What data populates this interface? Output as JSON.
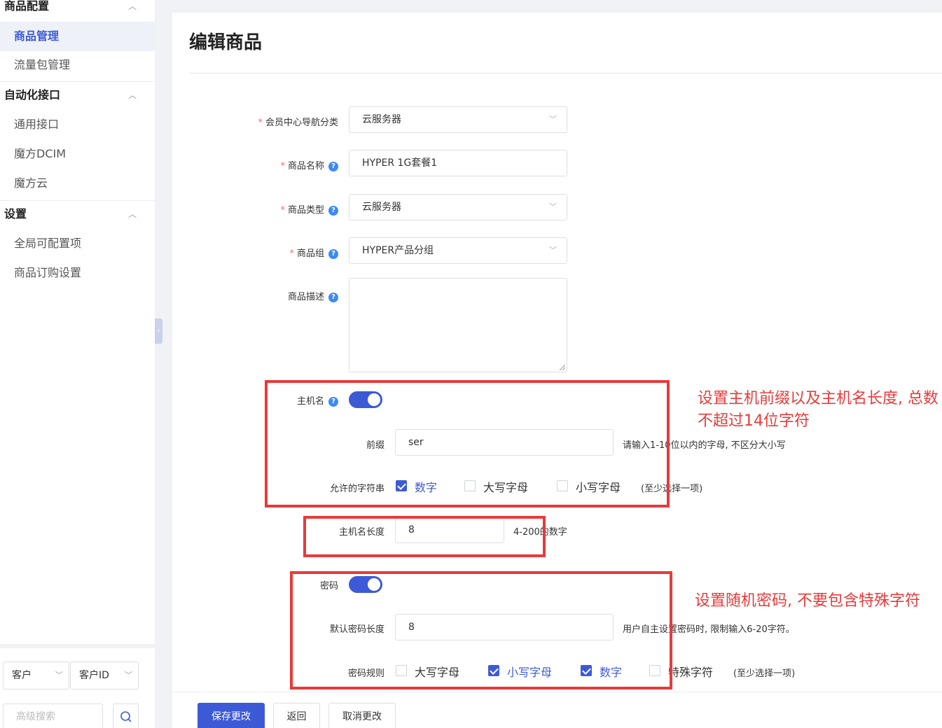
{
  "sidebar": {
    "sections": [
      {
        "title": "商品配置",
        "items": [
          "商品管理",
          "流量包管理"
        ]
      },
      {
        "title": "自动化接口",
        "items": [
          "通用接口",
          "魔方DCIM",
          "魔方云"
        ]
      },
      {
        "title": "设置",
        "items": [
          "全局可配置项",
          "商品订购设置"
        ]
      }
    ],
    "footer": {
      "filter_select": "客户",
      "id_select": "客户ID",
      "advanced_search_placeholder": "高级搜索"
    }
  },
  "page": {
    "title": "编辑商品"
  },
  "form": {
    "nav_category": {
      "label": "会员中心导航分类",
      "value": "云服务器"
    },
    "product_name": {
      "label": "商品名称",
      "value": "HYPER 1G套餐1"
    },
    "product_type": {
      "label": "商品类型",
      "value": "云服务器"
    },
    "product_group": {
      "label": "商品组",
      "value": "HYPER产品分组"
    },
    "product_desc": {
      "label": "商品描述",
      "value": ""
    },
    "hostname": {
      "label": "主机名",
      "enabled": true,
      "prefix_label": "前缀",
      "prefix_value": "ser",
      "prefix_hint": "请输入1-10位以内的字母, 不区分大小写",
      "charset_label": "允许的字符串",
      "charset": [
        {
          "label": "数字",
          "checked": true
        },
        {
          "label": "大写字母",
          "checked": false
        },
        {
          "label": "小写字母",
          "checked": false
        }
      ],
      "charset_hint": "(至少选择一项)",
      "length_label": "主机名长度",
      "length_value": "8",
      "length_hint": "4-200的数字"
    },
    "password": {
      "label": "密码",
      "enabled": true,
      "length_label": "默认密码长度",
      "length_value": "8",
      "length_hint": "用户自主设置密码时, 限制输入6-20字符。",
      "rule_label": "密码规则",
      "rules": [
        {
          "label": "大写字母",
          "checked": false
        },
        {
          "label": "小写字母",
          "checked": true
        },
        {
          "label": "数字",
          "checked": true
        },
        {
          "label": "特殊字符",
          "checked": false
        }
      ],
      "rule_hint": "(至少选择一项)"
    }
  },
  "annotations": {
    "hostname_note": "设置主机前缀以及主机名长度, 总数不超过14位字符",
    "password_note": "设置随机密码, 不要包含特殊字符"
  },
  "buttons": {
    "save": "保存更改",
    "back": "返回",
    "cancel": "取消更改"
  },
  "colors": {
    "primary": "#3d5ad6",
    "annotation_red": "#e83a3a",
    "required": "#f56c6c"
  }
}
